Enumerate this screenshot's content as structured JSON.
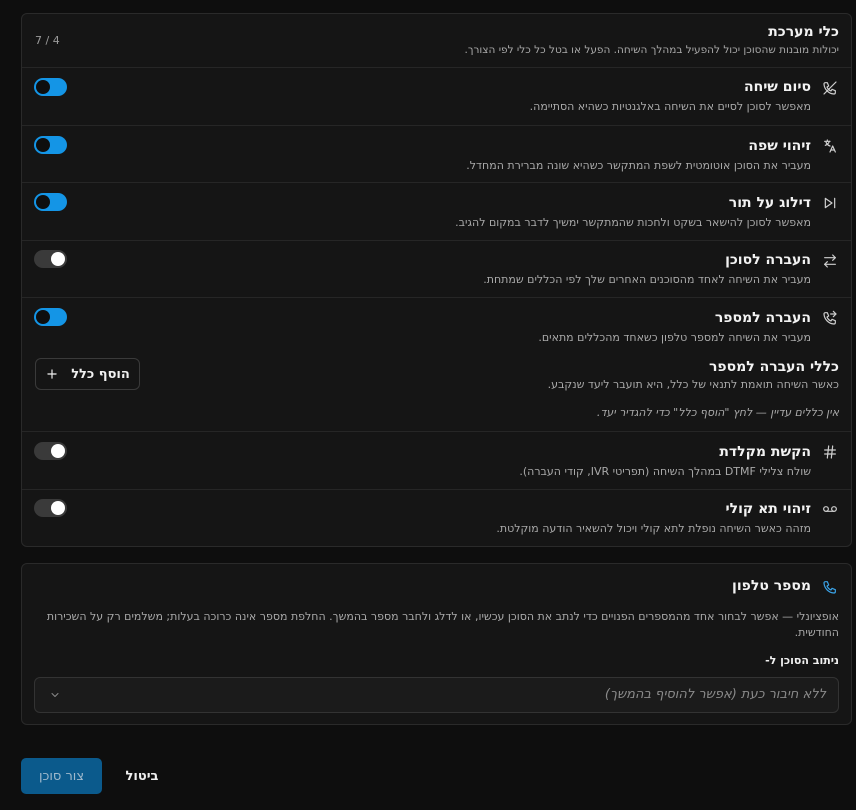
{
  "system_tools": {
    "title": "כלי מערכת",
    "description": "יכולות מובנות שהסוכן יכול להפעיל במהלך השיחה. הפעל או בטל כל כלי לפי הצורך.",
    "counter": "7 / 4",
    "items": [
      {
        "label": "סיום שיחה",
        "description": "מאפשר לסוכן לסיים את השיחה באלגנטיות כשהיא הסתיימה.",
        "icon": "phone-off-icon",
        "enabled": true
      },
      {
        "label": "זיהוי שפה",
        "description": "מעביר את הסוכן אוטומטית לשפת המתקשר כשהיא שונה מברירת המחדל.",
        "icon": "translate-icon",
        "enabled": true
      },
      {
        "label": "דילוג על תור",
        "description": "מאפשר לסוכן להישאר בשקט ולחכות שהמתקשר ימשיך לדבר במקום להגיב.",
        "icon": "skip-turn-icon",
        "enabled": true
      },
      {
        "label": "העברה לסוכן",
        "description": "מעביר את השיחה לאחד מהסוכנים האחרים שלך לפי הכללים שמתחת.",
        "icon": "transfer-arrows-icon",
        "enabled": false
      },
      {
        "label": "העברה למספר",
        "description": "מעביר את השיחה למספר טלפון כשאחד מהכללים מתאים.",
        "icon": "phone-forward-icon",
        "enabled": true
      },
      {
        "label": "הקשת מקלדת",
        "description": "שולח צלילי DTMF במהלך השיחה (תפריטי IVR, קודי העברה).",
        "icon": "hash-icon",
        "enabled": false
      },
      {
        "label": "זיהוי תא קולי",
        "description": "מזהה כאשר השיחה נופלת לתא קולי ויכול להשאיר הודעה מוקלטת.",
        "icon": "voicemail-icon",
        "enabled": false
      }
    ],
    "transfer_rules": {
      "title": "כללי העברה למספר",
      "description": "כאשר השיחה תואמת לתנאי של כלל, היא תועבר ליעד שנקבע.",
      "empty_text": "אין כללים עדיין — לחץ \"הוסף כלל\" כדי להגדיר יעד.",
      "add_button": "הוסף כלל"
    }
  },
  "phone_number": {
    "title": "מספר טלפון",
    "description_line1": "אופציונלי — אפשר לבחור אחד מהמספרים הפנויים כדי לנתב את הסוכן עכשיו, או לדלג ולחבר מספר בהמשך. החלפת מספר אינה כרוכה בעלות; משלמים רק על השכירות",
    "description_line2": "החודשית.",
    "route_label": "ניתוב הסוכן ל-",
    "select_value": "ללא חיבור כעת (אפשר להוסיף בהמשך)"
  },
  "footer": {
    "create_button": "צור סוכן",
    "cancel_button": "ביטול"
  }
}
